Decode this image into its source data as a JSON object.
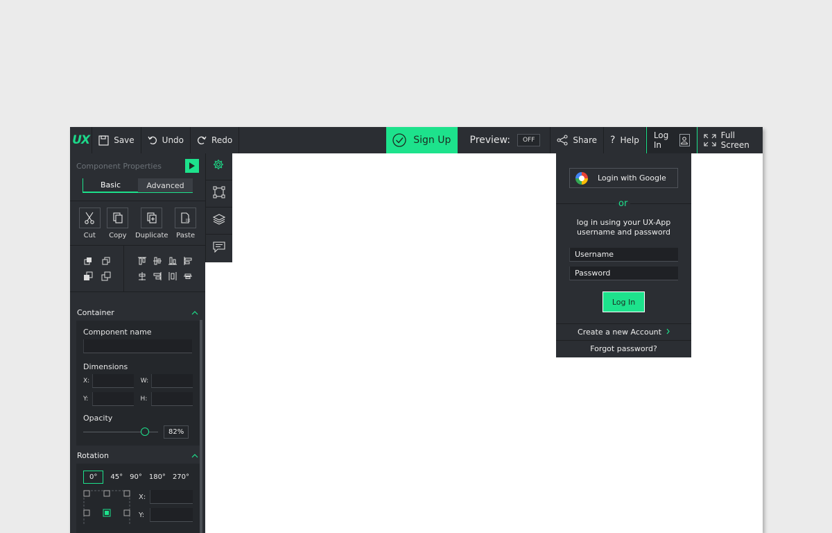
{
  "toolbar": {
    "logo": "UX",
    "save": "Save",
    "undo": "Undo",
    "redo": "Redo",
    "signup": "Sign Up",
    "preview": "Preview:",
    "preview_toggle": "OFF",
    "share": "Share",
    "help": "Help",
    "login": "Log In",
    "fullscreen": "Full Screen"
  },
  "panel": {
    "title": "Component Properties",
    "tabs": [
      "Basic",
      "Advanced"
    ],
    "tools": [
      "Cut",
      "Copy",
      "Duplicate",
      "Paste"
    ],
    "container": {
      "heading": "Container",
      "component_name_label": "Component name",
      "dimensions_label": "Dimensions",
      "x": "X:",
      "w": "W:",
      "y": "Y:",
      "h": "H:",
      "opacity_label": "Opacity",
      "opacity_value": "82%"
    },
    "rotation": {
      "heading": "Rotation",
      "options": [
        "0°",
        "45°",
        "90°",
        "180°",
        "270°"
      ],
      "x": "X:",
      "y": "Y:"
    }
  },
  "dropdown": {
    "google": "Login with Google",
    "or": "or",
    "message_line1": "log in using your UX-App",
    "message_line2": "username and password",
    "username_placeholder": "Username",
    "password_placeholder": "Password",
    "login_button": "Log In",
    "create_account": "Create a new Account",
    "forgot": "Forgot password?"
  },
  "colors": {
    "accent": "#1de28c",
    "panel": "#2b2e33",
    "background": "#ebebeb"
  }
}
